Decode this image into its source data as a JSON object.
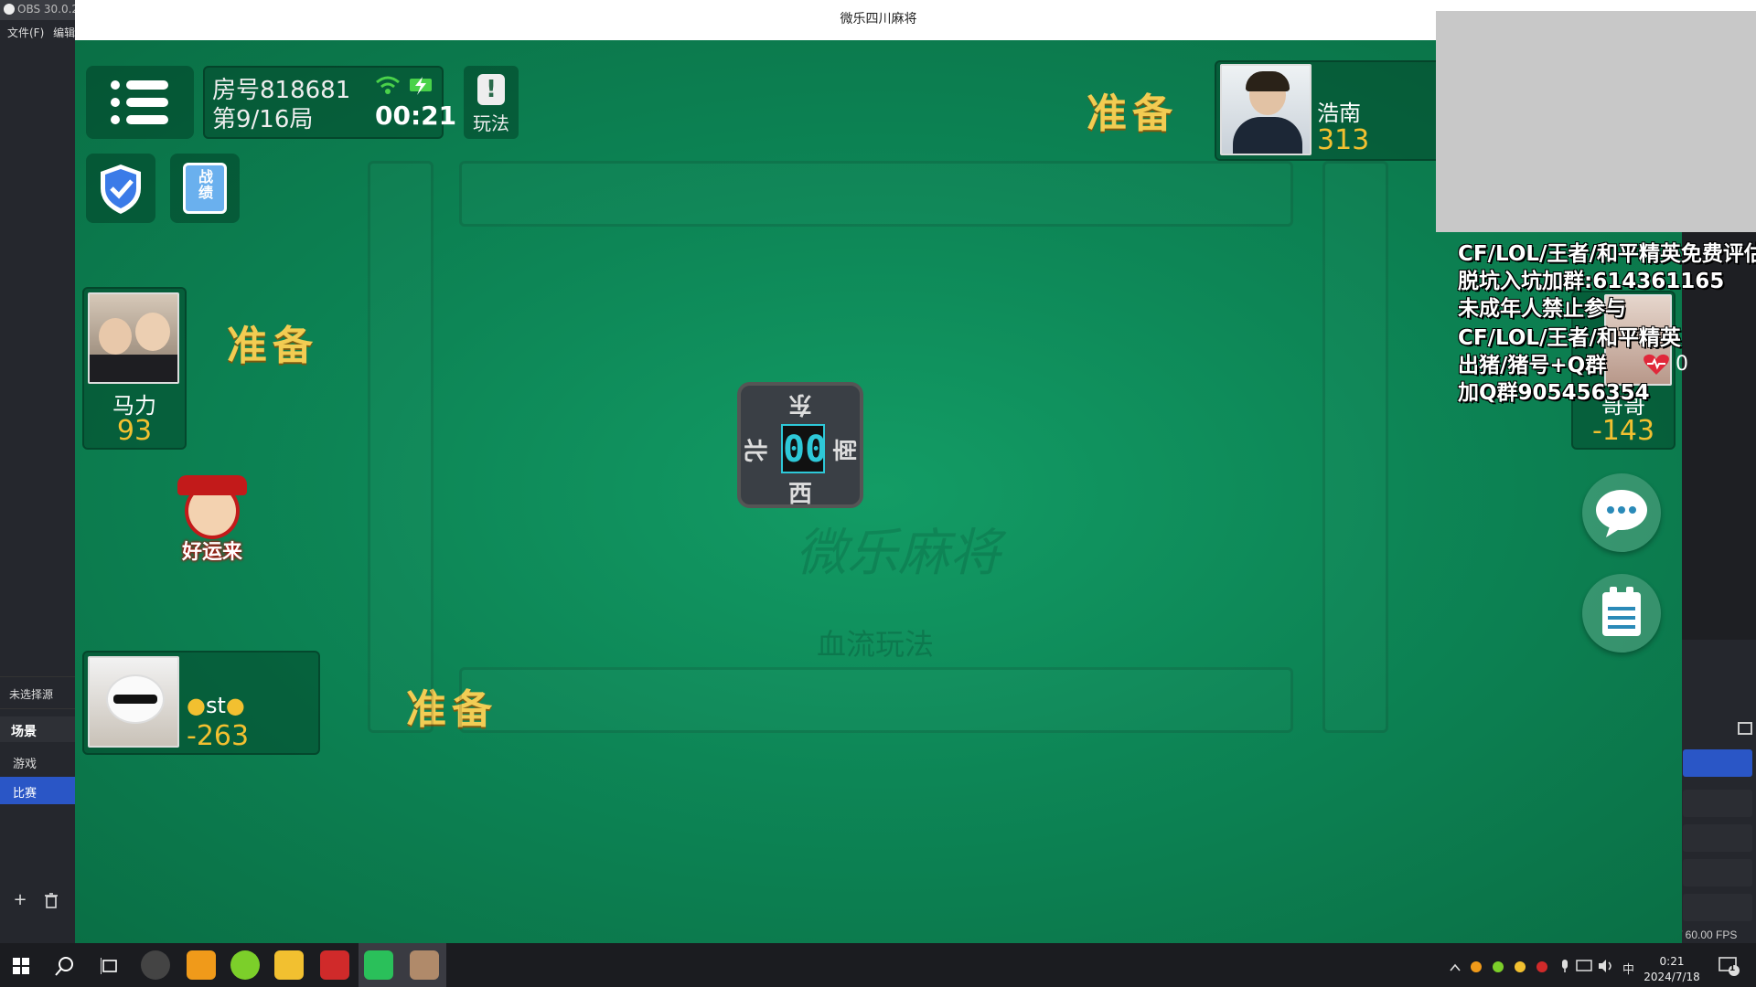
{
  "obs": {
    "title": "OBS 30.0.2",
    "menu_file": "文件(F)",
    "menu_edit": "编辑",
    "no_source": "未选择源",
    "scenes_header": "场景",
    "scenes": [
      "游戏",
      "比赛"
    ],
    "active_scene": "比赛",
    "add_icon": "+",
    "delete_icon": "🗑",
    "fps": "/ 60.00 FPS"
  },
  "window": {
    "title": "微乐四川麻将"
  },
  "room": {
    "number": "房号818681",
    "round": "第9/16局",
    "time": "00:21",
    "rules_label": "玩法"
  },
  "buttons": {
    "record_label": "战绩"
  },
  "ready_text": "准备",
  "players": {
    "top": {
      "name": "浩南",
      "score": "313"
    },
    "left": {
      "name": "马力",
      "score": "93"
    },
    "bottom": {
      "name": "st",
      "score": "-263"
    },
    "right": {
      "name": "哥哥",
      "score": "-143"
    }
  },
  "compass": {
    "east": "东",
    "south": "南",
    "west": "西",
    "north": "北",
    "count": "00"
  },
  "table": {
    "watermark": "微乐麻将",
    "mode": "血流玩法"
  },
  "lucky_badge": "好运来",
  "overlay": {
    "line1": "CF/LOL/王者/和平精英免费评估",
    "line2": "脱坑入坑加群:614361165",
    "line3": "未成年人禁止参与",
    "line4": "CF/LOL/王者/和平精英",
    "line5": "出猪/猪号+Q群",
    "line6": "加Q群905456354",
    "heart_count": "0"
  },
  "taskbar": {
    "ime": "中",
    "time": "0:21",
    "date": "2024/7/18",
    "notif_count": "1"
  },
  "colors": {
    "table_green": "#0d8656",
    "ready_gold": "#f2cc52",
    "score_gold": "#f2c030",
    "obs_active": "#2a56c6"
  }
}
